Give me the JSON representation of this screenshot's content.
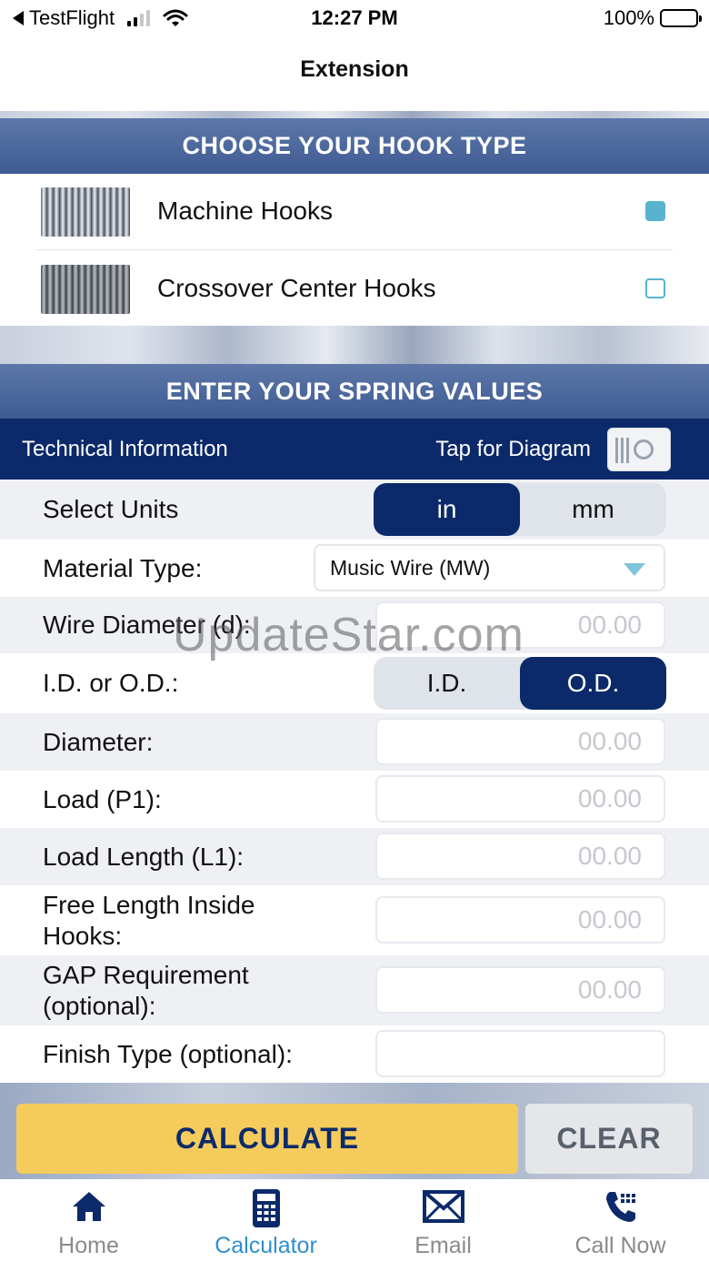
{
  "status_bar": {
    "back_app": "TestFlight",
    "time": "12:27 PM",
    "battery": "100%"
  },
  "nav": {
    "title": "Extension"
  },
  "hook_section": {
    "title": "CHOOSE YOUR HOOK TYPE",
    "options": [
      {
        "label": "Machine Hooks",
        "checked": true
      },
      {
        "label": "Crossover Center Hooks",
        "checked": false
      }
    ]
  },
  "values_section": {
    "title": "ENTER YOUR SPRING VALUES"
  },
  "tech_bar": {
    "left": "Technical Information",
    "right": "Tap for Diagram"
  },
  "form": {
    "units": {
      "label": "Select Units",
      "options": [
        "in",
        "mm"
      ],
      "selected": "in"
    },
    "material": {
      "label": "Material Type:",
      "value": "Music Wire (MW)"
    },
    "wire_diameter": {
      "label": "Wire Diameter (d):",
      "placeholder": "00.00"
    },
    "id_od": {
      "label": "I.D. or O.D.:",
      "options": [
        "I.D.",
        "O.D."
      ],
      "selected": "O.D."
    },
    "diameter": {
      "label": "Diameter:",
      "placeholder": "00.00"
    },
    "load": {
      "label": "Load (P1):",
      "placeholder": "00.00"
    },
    "load_length": {
      "label": "Load Length (L1):",
      "placeholder": "00.00"
    },
    "free_length": {
      "label_line1": "Free Length Inside",
      "label_line2": "Hooks:",
      "placeholder": "00.00"
    },
    "gap": {
      "label_line1": "GAP Requirement",
      "label_line2": "(optional):",
      "placeholder": "00.00"
    },
    "finish": {
      "label": "Finish Type (optional):",
      "placeholder": ""
    }
  },
  "actions": {
    "calculate": "CALCULATE",
    "clear": "CLEAR"
  },
  "tabs": [
    {
      "label": "Home",
      "icon": "home-icon",
      "active": false
    },
    {
      "label": "Calculator",
      "icon": "calculator-icon",
      "active": true
    },
    {
      "label": "Email",
      "icon": "email-icon",
      "active": false
    },
    {
      "label": "Call Now",
      "icon": "phone-icon",
      "active": false
    }
  ],
  "watermark": "UpdateStar.com",
  "colors": {
    "navy": "#0c2a6a",
    "banner": "#4a66a0",
    "accent_check": "#57b3cf",
    "calculate": "#f5cb5c",
    "tab_active": "#2f8fd1"
  }
}
